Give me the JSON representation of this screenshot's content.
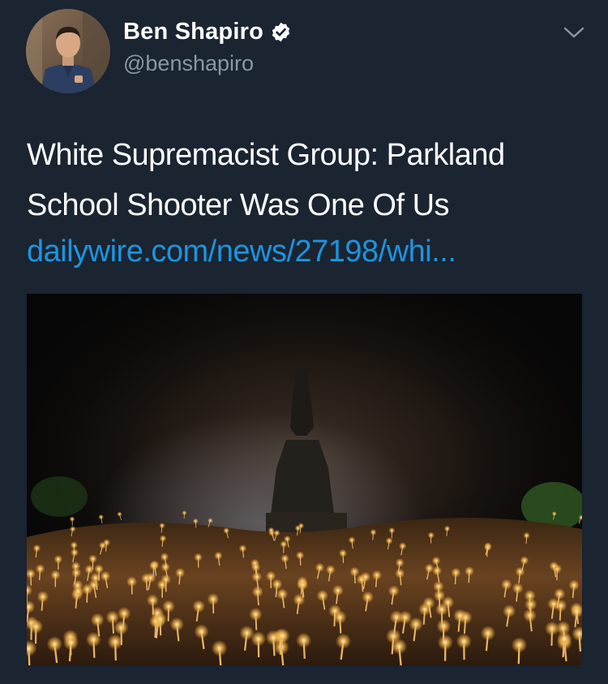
{
  "author": {
    "display_name": "Ben Shapiro",
    "handle": "@benshapiro",
    "verified": true,
    "avatar_icon": "user-avatar"
  },
  "tweet": {
    "text_lines": [
      "White Supremacist Group: Parkland",
      "School Shooter Was One Of Us"
    ],
    "link": "dailywire.com/news/27198/whi..."
  },
  "media": {
    "type": "photo",
    "icon": "image"
  },
  "icons": {
    "verified": "verified-badge-icon",
    "menu": "chevron-down-icon"
  },
  "colors": {
    "background": "#1b2431",
    "text": "#ffffff",
    "secondary_text": "#8899a6",
    "link": "#1b95e0"
  }
}
